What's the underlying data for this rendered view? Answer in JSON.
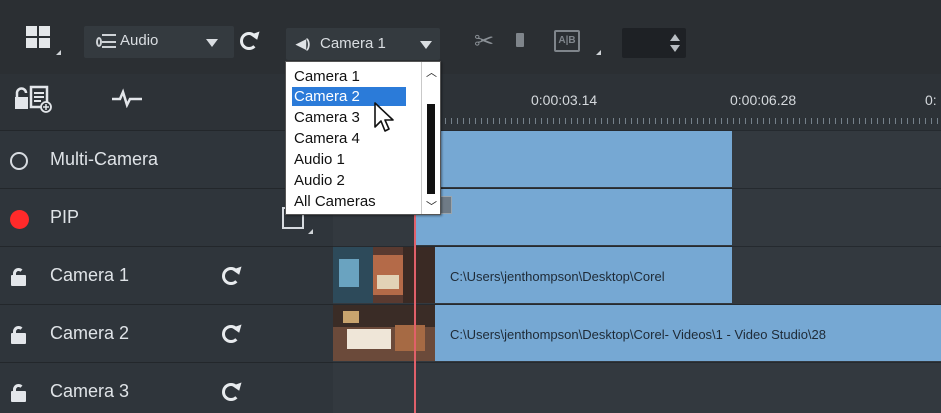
{
  "toolbar": {
    "source_label": "Audio",
    "camera_label": "Camera 1"
  },
  "dropdown": {
    "options": [
      "Camera 1",
      "Camera 2",
      "Camera 3",
      "Camera 4",
      "Audio 1",
      "Audio 2",
      "All Cameras"
    ],
    "selected": "Camera 2"
  },
  "ruler": {
    "times": [
      "0:00:03.14",
      "0:00:06.28",
      "0:"
    ]
  },
  "tracks": [
    {
      "name": "Multi-Camera",
      "icon": "circle-outline-icon"
    },
    {
      "name": "PIP",
      "icon": "record-dot-icon"
    },
    {
      "name": "Camera 1",
      "icon": "lock-icon"
    },
    {
      "name": "Camera 2",
      "icon": "lock-icon"
    },
    {
      "name": "Camera 3",
      "icon": "lock-icon"
    }
  ],
  "clips": {
    "camera1_path": "C:\\Users\\jenthompson\\Desktop\\Corel",
    "camera2_path": "C:\\Users\\jenthompson\\Desktop\\Corel- Videos\\1 - Video Studio\\28"
  },
  "colors": {
    "toolbar_bg": "#2b2f33",
    "track_bg": "#2f353b",
    "clip_blue": "#76a8d3",
    "selection_blue": "#2b7bd9",
    "record_red": "#ff2a2a",
    "playhead": "#e0606a"
  }
}
